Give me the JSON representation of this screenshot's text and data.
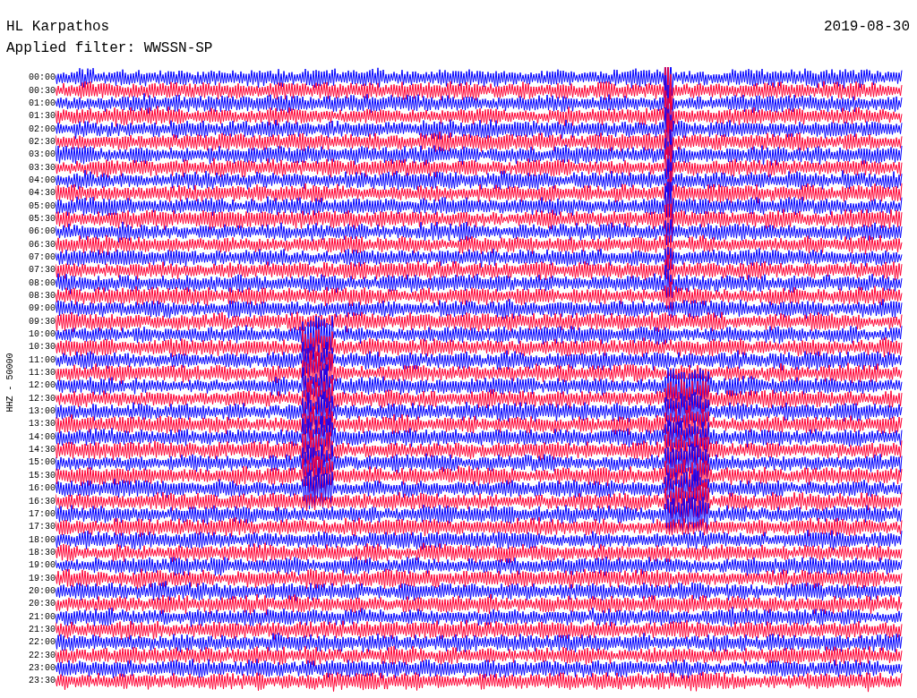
{
  "station": "HL Karpathos",
  "date": "2019-08-30",
  "filter": "Applied filter: WWSSN-SP",
  "channel_label": "HHZ - 50000",
  "time_labels": [
    "00:00",
    "00:30",
    "01:00",
    "01:30",
    "02:00",
    "02:30",
    "03:00",
    "03:30",
    "04:00",
    "04:30",
    "05:00",
    "05:30",
    "06:00",
    "06:30",
    "07:00",
    "07:30",
    "08:00",
    "08:30",
    "09:00",
    "09:30",
    "10:00",
    "10:30",
    "11:00",
    "11:30",
    "12:00",
    "12:30",
    "13:00",
    "13:30",
    "14:00",
    "14:30",
    "15:00",
    "15:30",
    "16:00",
    "16:30",
    "17:00",
    "17:30",
    "18:00",
    "18:30",
    "19:00",
    "19:30",
    "20:00",
    "20:30",
    "21:00",
    "21:30",
    "22:00",
    "22:30",
    "23:00",
    "23:30"
  ]
}
